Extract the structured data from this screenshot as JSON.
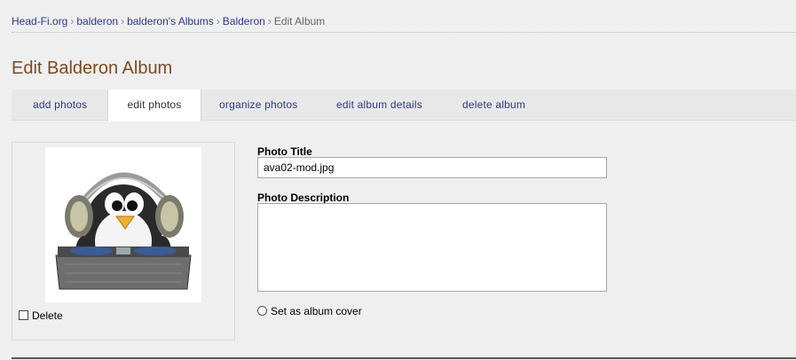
{
  "breadcrumb": {
    "items": [
      "Head-Fi.org",
      "balderon",
      "balderon's Albums",
      "Balderon"
    ],
    "separator": "›",
    "current": "Edit Album"
  },
  "page": {
    "title": "Edit Balderon Album"
  },
  "tabs": [
    {
      "label": "add photos",
      "active": false
    },
    {
      "label": "edit photos",
      "active": true
    },
    {
      "label": "organize photos",
      "active": false
    },
    {
      "label": "edit album details",
      "active": false
    },
    {
      "label": "delete album",
      "active": false
    }
  ],
  "photo": {
    "thumbnail_icon": "penguin-dj-icon",
    "delete_label": "Delete",
    "delete_checked": false
  },
  "form": {
    "title_label": "Photo Title",
    "title_value": "ava02-mod.jpg",
    "description_label": "Photo Description",
    "description_value": "",
    "cover_label": "Set as album cover",
    "cover_checked": false
  },
  "colors": {
    "link": "#2a3a8a",
    "title": "#7a4a22",
    "background": "#efefef"
  }
}
